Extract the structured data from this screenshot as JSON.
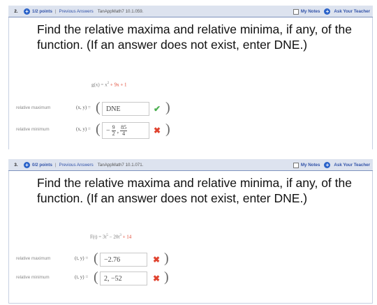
{
  "problems": [
    {
      "number": "2.",
      "points": "1/2 points",
      "separator": "|",
      "previous_answers": "Previous Answers",
      "code": "TanAppMath7 10.1.059.",
      "my_notes": "My Notes",
      "ask_teacher": "Ask Your Teacher",
      "question": "Find the relative maxima and relative minima, if any, of the function. (If an answer does not exist, enter DNE.)",
      "function": {
        "lhs": "g(x) = x",
        "exp": "2",
        "mid": " + 9x ",
        "tail": "+ 1"
      },
      "rows": [
        {
          "label": "relative maximum",
          "xy": "(x, y) =",
          "answer": "DNE",
          "status": "correct"
        },
        {
          "label": "relative minimum",
          "xy": "(x, y) =",
          "answer_prefix": "−",
          "frac1_num": "9",
          "frac1_den": "2",
          "comma": ",",
          "frac2_num": "85",
          "frac2_den": "4",
          "status": "incorrect"
        }
      ]
    },
    {
      "number": "3.",
      "points": "0/2 points",
      "separator": "|",
      "previous_answers": "Previous Answers",
      "code": "TanAppMath7 10.1.071.",
      "my_notes": "My Notes",
      "ask_teacher": "Ask Your Teacher",
      "question": "Find the relative maxima and relative minima, if any, of the function. (If an answer does not exist, enter DNE.)",
      "function": {
        "lhs": "F(t) = 3t",
        "exp1": "5",
        "mid": " − 20t",
        "exp2": "3",
        "tail": " + 14"
      },
      "rows": [
        {
          "label": "relative maximum",
          "xy": "(t, y) =",
          "answer": "−2.76",
          "status": "incorrect"
        },
        {
          "label": "relative minimum",
          "xy": "(t, y) =",
          "answer": "2, −52",
          "status": "incorrect"
        }
      ]
    }
  ],
  "icons": {
    "check": "✔",
    "cross": "✖",
    "plus": "+"
  },
  "colors": {
    "header_bg": "#dde3ef",
    "link": "#3253a8",
    "correct": "#4caf50",
    "incorrect": "#e0432f"
  }
}
